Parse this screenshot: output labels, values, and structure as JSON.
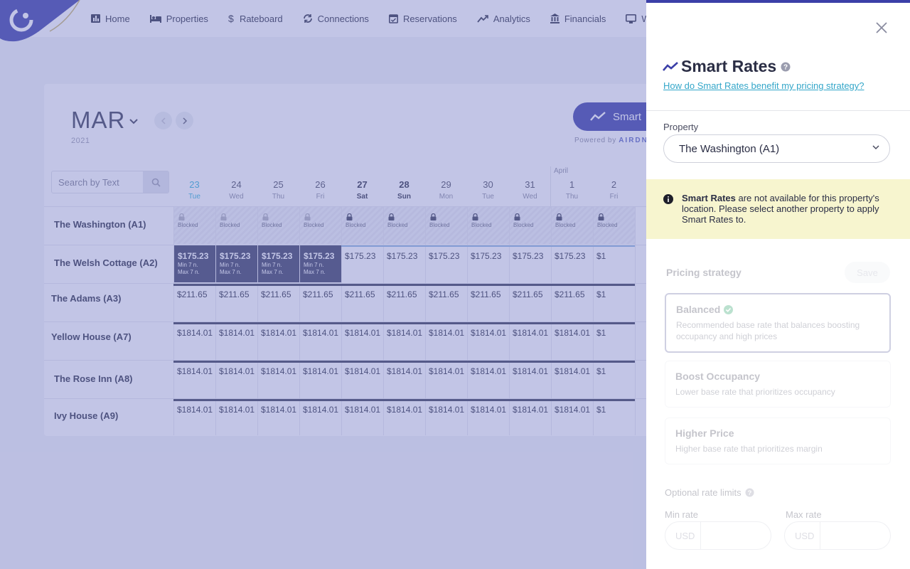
{
  "nav": {
    "items": [
      {
        "label": "Home",
        "icon": "bar-chart-icon"
      },
      {
        "label": "Properties",
        "icon": "bed-icon"
      },
      {
        "label": "Rateboard",
        "icon": "dollar-icon"
      },
      {
        "label": "Connections",
        "icon": "sync-icon"
      },
      {
        "label": "Reservations",
        "icon": "calendar-check-icon"
      },
      {
        "label": "Analytics",
        "icon": "trend-icon"
      },
      {
        "label": "Financials",
        "icon": "bank-icon"
      },
      {
        "label": "Web",
        "icon": "monitor-icon"
      }
    ]
  },
  "calendar": {
    "month": "MAR",
    "year": "2021",
    "smart_button": "Smart",
    "powered_prefix": "Powered by",
    "powered_brand": "AIRDNA",
    "search_placeholder": "Search by Text",
    "april_label": "April",
    "days": [
      {
        "num": "23",
        "dow": "Tue",
        "today": true
      },
      {
        "num": "24",
        "dow": "Wed"
      },
      {
        "num": "25",
        "dow": "Thu"
      },
      {
        "num": "26",
        "dow": "Fri"
      },
      {
        "num": "27",
        "dow": "Sat",
        "weekend": true
      },
      {
        "num": "28",
        "dow": "Sun",
        "weekend": true
      },
      {
        "num": "29",
        "dow": "Mon"
      },
      {
        "num": "30",
        "dow": "Tue"
      },
      {
        "num": "31",
        "dow": "Wed"
      },
      {
        "num": "1",
        "dow": "Thu"
      },
      {
        "num": "2",
        "dow": "Fri"
      }
    ],
    "blocked_label": "Blocked",
    "min_label": "Min 7 n.",
    "max_label": "Max 7 n.",
    "rows": [
      {
        "name": "The Washington (A1)",
        "type": "blocked"
      },
      {
        "name": "The Welsh Cottage (A2)",
        "type": "welsh",
        "rate": "$175.23"
      },
      {
        "name": "The Adams (A3)",
        "type": "rate",
        "rate": "$211.65"
      },
      {
        "name": "Yellow House (A7)",
        "type": "rate",
        "rate": "$1814.01"
      },
      {
        "name": "The Rose Inn (A8)",
        "type": "rate",
        "rate": "$1814.01"
      },
      {
        "name": "Ivy House (A9)",
        "type": "rate",
        "rate": "$1814.01"
      }
    ],
    "overflow_cell": "$1"
  },
  "panel": {
    "title": "Smart Rates",
    "link": "How do Smart Rates benefit my pricing strategy?",
    "property_label": "Property",
    "property_value": "The Washington (A1)",
    "warning_bold": "Smart Rates",
    "warning_text": " are not available for this property's location. Please select another property to apply Smart Rates to.",
    "strategy_label": "Pricing strategy",
    "save_label": "Save",
    "options": [
      {
        "title": "Balanced",
        "desc": "Recommended base rate that balances boosting occupancy and high prices",
        "selected": true
      },
      {
        "title": "Boost Occupancy",
        "desc": "Lower base rate that prioritizes occupancy"
      },
      {
        "title": "Higher Price",
        "desc": "Higher base rate that prioritizes margin"
      }
    ],
    "limits_label": "Optional rate limits",
    "min_rate_label": "Min rate",
    "max_rate_label": "Max rate",
    "currency": "USD"
  },
  "colors": {
    "accent": "#3b3fa8",
    "link": "#33a6c9",
    "warning_bg": "#f7f5cf",
    "today": "#33b5d9"
  }
}
